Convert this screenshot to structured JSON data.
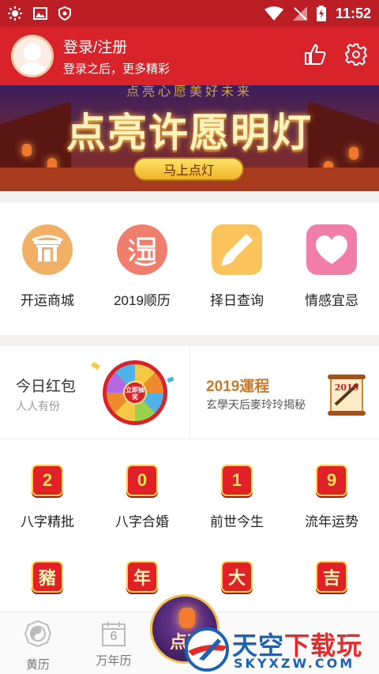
{
  "status_bar": {
    "time": "11:52"
  },
  "header": {
    "login_title": "登录/注册",
    "login_subtitle": "登录之后，更多精彩"
  },
  "banner": {
    "top_text": "点亮心愿美好未来",
    "headline": "点亮许愿明灯",
    "button": "马上点灯"
  },
  "shortcuts": [
    {
      "label": "开运商城",
      "icon": "gate-icon",
      "color": "#f2b067"
    },
    {
      "label": "2019顺历",
      "icon": "calendar-glyph-icon",
      "color": "#ef7f6c"
    },
    {
      "label": "择日查询",
      "icon": "brush-icon",
      "color": "#fbc35c"
    },
    {
      "label": "情感宜忌",
      "icon": "heart-icon",
      "color": "#f17ea8"
    }
  ],
  "promo": {
    "left": {
      "title": "今日红包",
      "subtitle": "人人有份",
      "wheel_text": "立即抽奖"
    },
    "right": {
      "title": "2019運程",
      "subtitle": "玄學天后麥玲玲揭秘",
      "scroll_text": "2019"
    }
  },
  "fortune_row1": [
    {
      "glyph": "2",
      "label": "八字精批"
    },
    {
      "glyph": "0",
      "label": "八字合婚"
    },
    {
      "glyph": "1",
      "label": "前世今生"
    },
    {
      "glyph": "9",
      "label": "流年运势"
    }
  ],
  "fortune_row2": [
    {
      "glyph": "豬"
    },
    {
      "glyph": "年"
    },
    {
      "glyph": "大"
    },
    {
      "glyph": "吉"
    }
  ],
  "bottom_nav": [
    {
      "label": "黄历",
      "icon": "taiji-icon"
    },
    {
      "label": "万年历",
      "icon": "calendar-icon",
      "day": "6"
    },
    {
      "label": "",
      "icon": "lantern-fab-icon",
      "fab_text": "点亮"
    }
  ],
  "watermark": {
    "cn_a": "天空",
    "cn_b": "下载玩",
    "en": "SKYXZW.COM"
  }
}
